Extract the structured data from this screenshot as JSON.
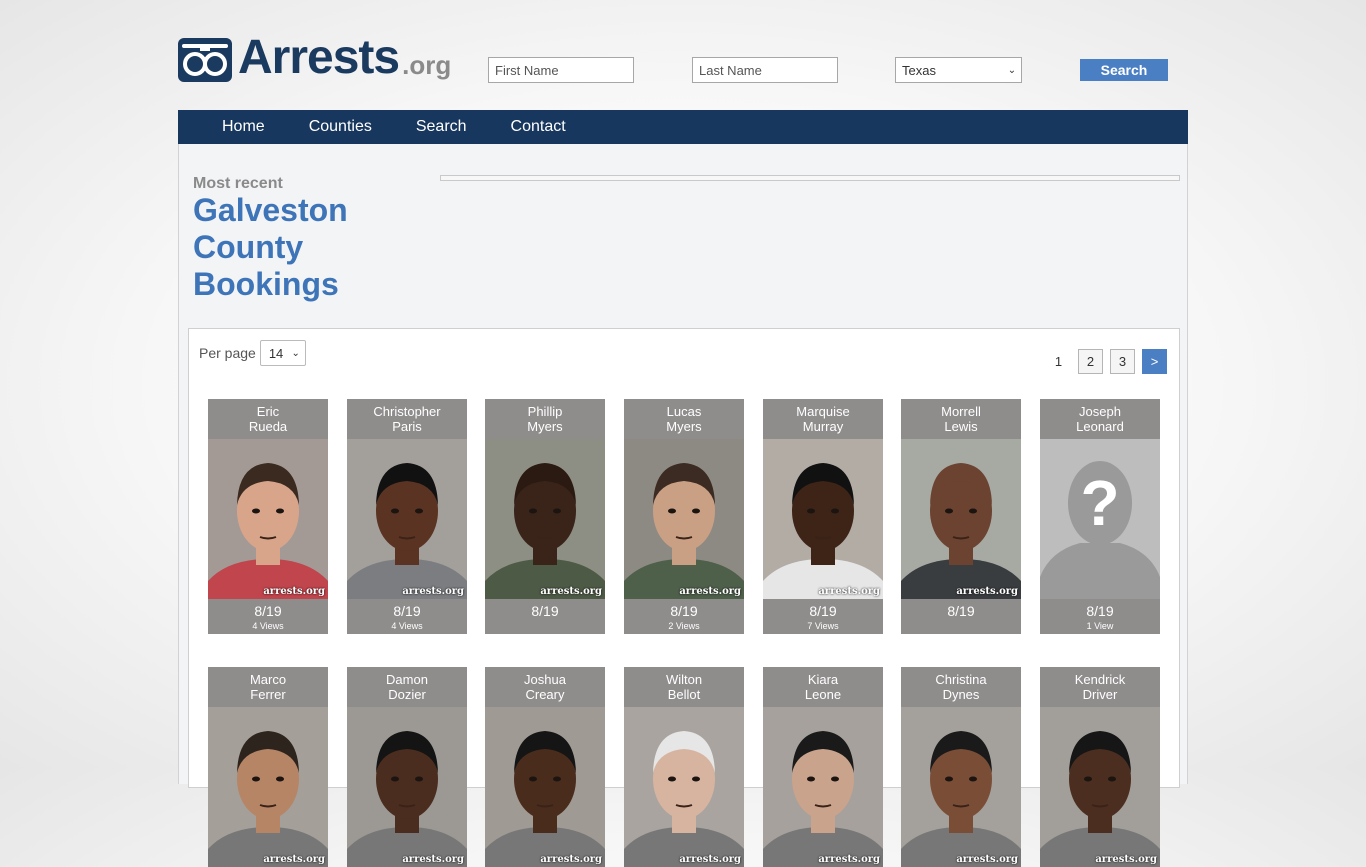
{
  "site": {
    "logo_main": "Arrests",
    "logo_suffix": ".org"
  },
  "search": {
    "first_placeholder": "First Name",
    "last_placeholder": "Last Name",
    "state_selected": "Texas",
    "button_label": "Search"
  },
  "nav": {
    "items": [
      {
        "label": "Home"
      },
      {
        "label": "Counties"
      },
      {
        "label": "Search"
      },
      {
        "label": "Contact"
      }
    ]
  },
  "page": {
    "most_recent": "Most recent",
    "title": "Galveston County Bookings"
  },
  "listing": {
    "per_page_label": "Per page",
    "per_page_value": "14",
    "pages": [
      "1",
      "2",
      "3"
    ],
    "next_label": ">",
    "current_page": "1"
  },
  "bookings": [
    {
      "first": "Eric",
      "last": "Rueda",
      "date": "8/19",
      "views": "4 Views",
      "photo": "mugshot",
      "skin": "#d9a58a",
      "hair": "#3a2a20",
      "bg": "#a39a96",
      "shirt": "#c0454c"
    },
    {
      "first": "Christopher",
      "last": "Paris",
      "date": "8/19",
      "views": "4 Views",
      "photo": "mugshot",
      "skin": "#5a3322",
      "hair": "#111111",
      "bg": "#a39f9b",
      "shirt": "#7b7d80"
    },
    {
      "first": "Phillip",
      "last": "Myers",
      "date": "8/19",
      "views": "",
      "photo": "mugshot",
      "skin": "#3a2419",
      "hair": "#2a1a12",
      "bg": "#8e8f84",
      "shirt": "#4d5a45"
    },
    {
      "first": "Lucas",
      "last": "Myers",
      "date": "8/19",
      "views": "2 Views",
      "photo": "mugshot",
      "skin": "#caa085",
      "hair": "#3b2b22",
      "bg": "#8d8a84",
      "shirt": "#4e5f4a"
    },
    {
      "first": "Marquise",
      "last": "Murray",
      "date": "8/19",
      "views": "7 Views",
      "photo": "mugshot",
      "skin": "#3d2417",
      "hair": "#111111",
      "bg": "#b2aca5",
      "shirt": "#e6e6e6"
    },
    {
      "first": "Morrell",
      "last": "Lewis",
      "date": "8/19",
      "views": "",
      "photo": "mugshot",
      "skin": "#6b4330",
      "hair": "#6b4330",
      "bg": "#a7a9a3",
      "shirt": "#3a3d40"
    },
    {
      "first": "Joseph",
      "last": "Leonard",
      "date": "8/19",
      "views": "1 View",
      "photo": "placeholder",
      "skin": "#7a7a7a",
      "hair": "#7a7a7a",
      "bg": "#9a9a9a",
      "shirt": "#7a7a7a"
    },
    {
      "first": "Marco",
      "last": "Ferrer",
      "date": "",
      "views": "",
      "photo": "mugshot",
      "skin": "#b58566",
      "hair": "#2e241e",
      "bg": "#a59f99",
      "shirt": "#777"
    },
    {
      "first": "Damon",
      "last": "Dozier",
      "date": "",
      "views": "",
      "photo": "mugshot",
      "skin": "#4a2d1e",
      "hair": "#141414",
      "bg": "#9c9894",
      "shirt": "#777"
    },
    {
      "first": "Joshua",
      "last": "Creary",
      "date": "",
      "views": "",
      "photo": "mugshot",
      "skin": "#4a2c1d",
      "hair": "#151515",
      "bg": "#a09a94",
      "shirt": "#777"
    },
    {
      "first": "Wilton",
      "last": "Bellot",
      "date": "",
      "views": "",
      "photo": "mugshot",
      "skin": "#d7b4a0",
      "hair": "#e6e6e6",
      "bg": "#a9a49f",
      "shirt": "#777"
    },
    {
      "first": "Kiara",
      "last": "Leone",
      "date": "",
      "views": "",
      "photo": "mugshot",
      "skin": "#caa38c",
      "hair": "#1a1a1a",
      "bg": "#a6a19c",
      "shirt": "#777"
    },
    {
      "first": "Christina",
      "last": "Dynes",
      "date": "",
      "views": "",
      "photo": "mugshot",
      "skin": "#7a4e36",
      "hair": "#1a1a1a",
      "bg": "#a4a09b",
      "shirt": "#777"
    },
    {
      "first": "Kendrick",
      "last": "Driver",
      "date": "",
      "views": "",
      "photo": "mugshot",
      "skin": "#4b2e1f",
      "hair": "#161616",
      "bg": "#a29e9a",
      "shirt": "#777"
    }
  ],
  "watermark": "arrests.org"
}
